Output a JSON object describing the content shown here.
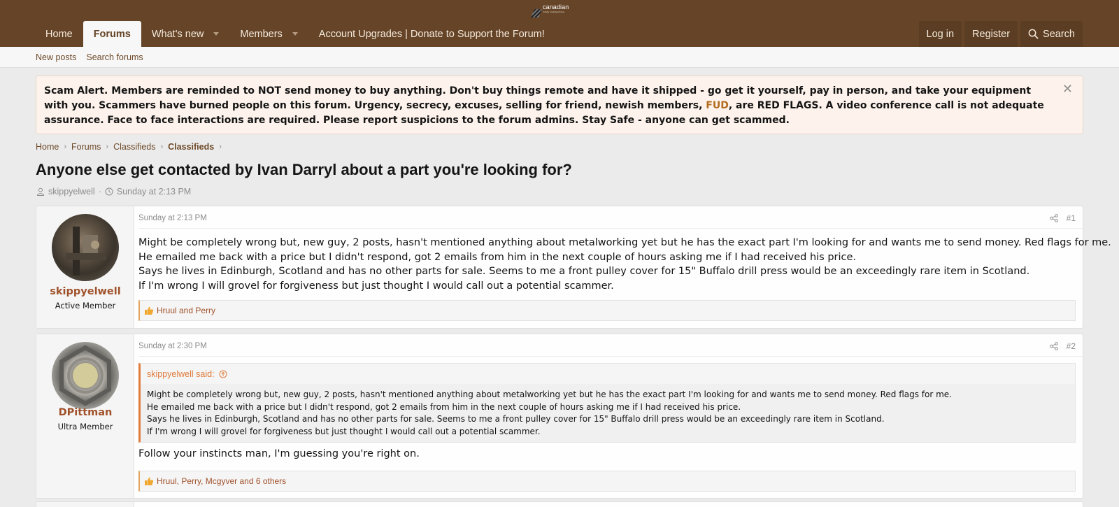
{
  "header": {
    "logo_text": "canadian",
    "logo_subtext": "hobby metalworking",
    "nav": [
      {
        "label": "Home"
      },
      {
        "label": "Forums"
      },
      {
        "label": "What's new"
      },
      {
        "label": "Members"
      },
      {
        "label": "Account Upgrades | Donate to Support the Forum!"
      }
    ],
    "login": "Log in",
    "register": "Register",
    "search": "Search"
  },
  "subnav": {
    "new_posts": "New posts",
    "search_forums": "Search forums"
  },
  "notice": {
    "text_before": "Scam Alert. Members are reminded to NOT send money to buy anything. Don't buy things remote and have it shipped - go get it yourself, pay in person, and take your equipment with you. Scammers have burned people on this forum. Urgency, secrecy, excuses, selling for friend, newish members, ",
    "link": "FUD",
    "text_after": ", are RED FLAGS. A video conference call is not adequate assurance. Face to face interactions are required. Please report suspicions to the forum admins. Stay Safe - anyone can get scammed.",
    "close": "✕"
  },
  "breadcrumb": [
    "Home",
    "Forums",
    "Classifieds",
    "Classifieds"
  ],
  "thread": {
    "title": "Anyone else get contacted by Ivan Darryl about a part you're looking for?",
    "author": "skippyelwell",
    "date": "Sunday at 2:13 PM"
  },
  "posts": [
    {
      "username": "skippyelwell",
      "usertitle": "Active Member",
      "date": "Sunday at 2:13 PM",
      "number": "#1",
      "lines": [
        "Might be completely wrong but, new guy, 2 posts, hasn't mentioned anything about metalworking yet but he has the exact part I'm looking for and wants me to send money. Red flags for me.",
        "He emailed me back with a price but I didn't respond, got 2 emails from him in the next couple of hours asking me if I had received his price.",
        "Says he lives in Edinburgh, Scotland and has no other parts for sale. Seems to me a front pulley cover for 15\" Buffalo drill press would be an exceedingly rare item in Scotland.",
        "If I'm wrong I will grovel for forgiveness but just thought I would call out a potential scammer."
      ],
      "reactions": "Hruul and Perry"
    },
    {
      "username": "DPittman",
      "usertitle": "Ultra Member",
      "date": "Sunday at 2:30 PM",
      "number": "#2",
      "quote_author": "skippyelwell said:",
      "quote_lines": [
        "Might be completely wrong but, new guy, 2 posts, hasn't mentioned anything about metalworking yet but he has the exact part I'm looking for and wants me to send money. Red flags for me.",
        "He emailed me back with a price but I didn't respond, got 2 emails from him in the next couple of hours asking me if I had received his price.",
        "Says he lives in Edinburgh, Scotland and has no other parts for sale. Seems to me a front pulley cover for 15\" Buffalo drill press would be an exceedingly rare item in Scotland.",
        "If I'm wrong I will grovel for forgiveness but just thought I would call out a potential scammer."
      ],
      "text": "Follow your instincts man, I'm guessing you're right on.",
      "reactions": "Hruul, Perry, Mcgyver and 6 others"
    }
  ],
  "colors": {
    "header_bg": "#654427",
    "accent": "#a0512a",
    "link": "#6e4a29",
    "quote_border": "#e07c3c"
  },
  "icons": [
    "search-icon",
    "user-icon",
    "clock-icon",
    "share-icon",
    "like-icon",
    "arrow-up-circle-icon",
    "close-icon",
    "chevron-down-icon",
    "chevron-right-icon"
  ]
}
